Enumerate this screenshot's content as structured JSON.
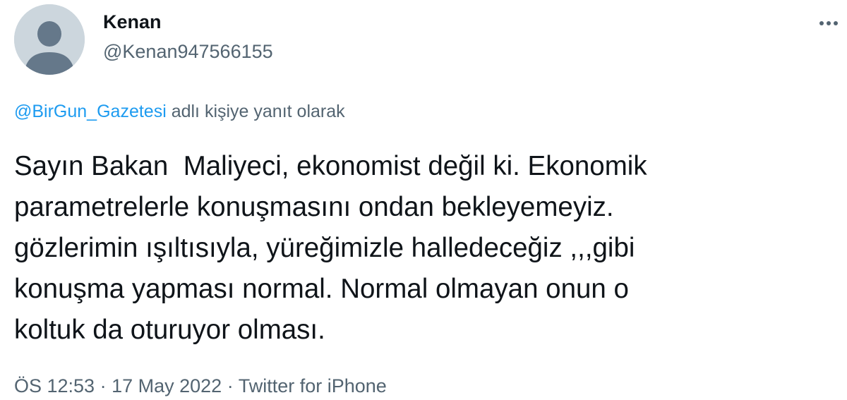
{
  "author": {
    "display_name": "Kenan",
    "handle": "@Kenan947566155",
    "avatar": "default-profile-silhouette-icon"
  },
  "more_icon": "more-horizontal-icon",
  "reply_context": {
    "mention": "@BirGun_Gazetesi",
    "suffix": " adlı kişiye yanıt olarak"
  },
  "tweet": {
    "lines": [
      "Sayın Bakan  Maliyeci, ekonomist değil ki. Ekonomik",
      "parametrelerle konuşmasını ondan bekleyemeyiz.",
      "gözlerimin ışıltısıyla, yüreğimizle halledeceğiz ,,,gibi",
      "konuşma yapması normal. Normal olmayan onun o",
      "koltuk da oturuyor olması."
    ]
  },
  "meta": {
    "time": "ÖS 12:53",
    "separator": " · ",
    "date": "17 May 2022",
    "source": "Twitter for iPhone"
  },
  "colors": {
    "text": "#0f1419",
    "secondary": "#536471",
    "link": "#1d9bf0",
    "avatar_bg": "#ccd6dd",
    "avatar_fg": "#657786"
  }
}
